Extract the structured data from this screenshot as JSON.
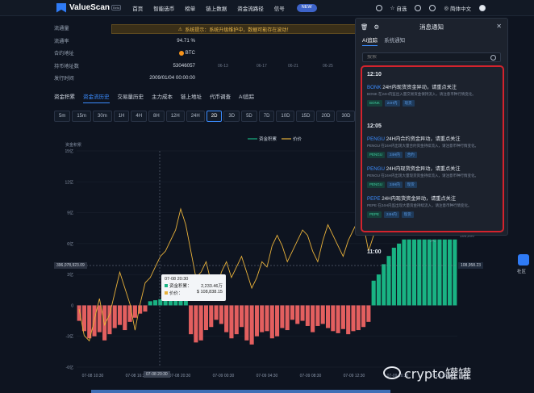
{
  "app": {
    "name": "ValueScan",
    "badge": "Beta"
  },
  "nav": [
    "首页",
    "智能选币",
    "榜单",
    "链上数据",
    "资金流路径",
    "信号"
  ],
  "nav_pill": "NEW",
  "top_right": {
    "watchlist": "自选",
    "language": "简体中文"
  },
  "notice": "系统提示：系统升级维护中，数据可能存在波动！",
  "info": [
    {
      "label": "流通量",
      "value": ""
    },
    {
      "label": "流通率",
      "value": "94.71 %"
    },
    {
      "label": "合约地址",
      "value": "BTC"
    },
    {
      "label": "持币地址数",
      "value": "53046057"
    },
    {
      "label": "发行时间",
      "value": "2009/01/04 00:00:00"
    }
  ],
  "top_ticks": [
    "06-13",
    "06-17",
    "06-21",
    "06-25"
  ],
  "subtabs": [
    "资金积累",
    "资金流历史",
    "交易量历史",
    "主力成本",
    "链上地址",
    "代币调查",
    "AI追踪"
  ],
  "subtab_active": 1,
  "intervals": [
    "5m",
    "15m",
    "30m",
    "1H",
    "4H",
    "8H",
    "12H",
    "24H",
    "2D",
    "3D",
    "5D",
    "7D",
    "10D",
    "15D",
    "20D",
    "30D",
    "40D",
    "50D",
    "60D",
    "90D"
  ],
  "interval_active": 8,
  "chart_data": {
    "type": "bar",
    "title": "",
    "legend": [
      "资金积累",
      "价价"
    ],
    "y_left_label": "资金积累",
    "y_left_ticks": [
      "15亿",
      "12亿",
      "9亿",
      "6亿",
      "3亿",
      "0",
      "-3亿",
      "-6亿"
    ],
    "y_right_ticks": [
      "108,500",
      "108,000"
    ],
    "x_labels": [
      "07-08 10:30",
      "07-08 16:30",
      "07-08 20:30",
      "07-09 00:30",
      "07-09 04:30",
      "07-09 08:30",
      "07-09 12:30",
      "07-09 16:30",
      "07-09 20:30"
    ],
    "left_marker": "396,078,923.09",
    "right_marker": "108,958.23",
    "values": [
      -1.5,
      -2.5,
      -3.2,
      -3.0,
      -2.6,
      -3.4,
      -2.8,
      -2.2,
      -1.9,
      -2.4,
      -1.6,
      -1.2,
      -0.8,
      -0.6,
      0.4,
      0.5,
      0.6,
      0.9,
      1.4,
      1.2,
      0.9,
      0.5,
      -2.8,
      -3.6,
      -3.4,
      -2.4,
      -2.1,
      -1.4,
      -1.8,
      -2.6,
      -3.2,
      -2.8,
      -2.1,
      -3.4,
      -3.8,
      -3.0,
      -2.6,
      -2.5,
      -3.2,
      -3.0,
      -2.2,
      -2.4,
      -1.4,
      -1.8,
      -1.5,
      -2.0,
      -2.6,
      -2.0,
      -1.8,
      -2.2,
      -2.5,
      -2.7,
      -2.3,
      -2.8,
      -2.5,
      -2.4,
      -2.1,
      -1.6,
      2.4,
      3.0,
      4.0,
      4.8,
      5.6,
      6.0,
      6.4,
      6.4,
      6.4,
      6.4,
      6.4,
      6.4,
      6.4,
      6.4,
      6.4,
      6.4,
      6.4
    ],
    "price": [
      106600,
      106100,
      106000,
      106400,
      106800,
      106300,
      106500,
      106900,
      107300,
      107000,
      106700,
      106200,
      106700,
      107100,
      107200,
      107400,
      107600,
      107700,
      107900,
      108100,
      108500,
      108200,
      107700,
      107200,
      107300,
      107500,
      107100,
      106900,
      107300,
      107500,
      107200,
      107400,
      107600,
      107300,
      107000,
      107200,
      107500,
      107400,
      107800,
      108000,
      107800,
      107500,
      107700,
      107900,
      108100,
      108000,
      107700,
      107500,
      107900,
      108200,
      108000,
      107800,
      107600,
      107900,
      108100,
      108300,
      108200,
      107700,
      108000,
      108400,
      108700,
      108900,
      108900,
      109000,
      109200,
      109300,
      109300,
      109000,
      109100,
      108900,
      109000,
      109100,
      109200,
      109000,
      108950
    ]
  },
  "tooltip": {
    "time": "07-08 20:30",
    "acc_label": "资金积累：",
    "acc_value": "2,233.46万",
    "price_label": "价价：",
    "price_value": "$ 108,838.15"
  },
  "time_marker": "07-08 20:30",
  "panel": {
    "title": "消息通知",
    "tabs": [
      "AI追踪",
      "系统通知"
    ],
    "search_placeholder": "搜索",
    "groups": [
      {
        "time": "12:10",
        "items": [
          {
            "sym": "BONK",
            "title": " 24H内现货资金异动，请重点关注",
            "desc": "BONK 在24H内监出入量交易资金保持流入，请注意币种行情变化。",
            "tags": [
              "BONK",
              "24H内",
              "现货"
            ]
          }
        ]
      },
      {
        "time": "12:05",
        "items": [
          {
            "sym": "PENGU",
            "title": " 24H内合约资金异动，请重点关注",
            "desc": "PENGU 在24H内出现大量合约资金持续流入，请注意币种行情变化。",
            "tags": [
              "PENGU",
              "24H内",
              "合约"
            ]
          },
          {
            "sym": "PENGU",
            "title": " 24H内现货资金异动，请重点关注",
            "desc": "PENGU 在24H内出现大量现货资金持续流入，请注意币种行情变化。",
            "tags": [
              "PENGU",
              "24H内",
              "现货"
            ]
          },
          {
            "sym": "PEPE",
            "title": " 24H内现货资金异动，请重点关注",
            "desc": "PEPE 在24H内监出现大量资金持续流入，请注意币种行情变化。",
            "tags": [
              "PEPE",
              "24H内",
              "现货"
            ]
          }
        ]
      }
    ],
    "next_time": "11:00"
  },
  "float": {
    "label": "社区"
  },
  "watermark": "crypto罐罐"
}
